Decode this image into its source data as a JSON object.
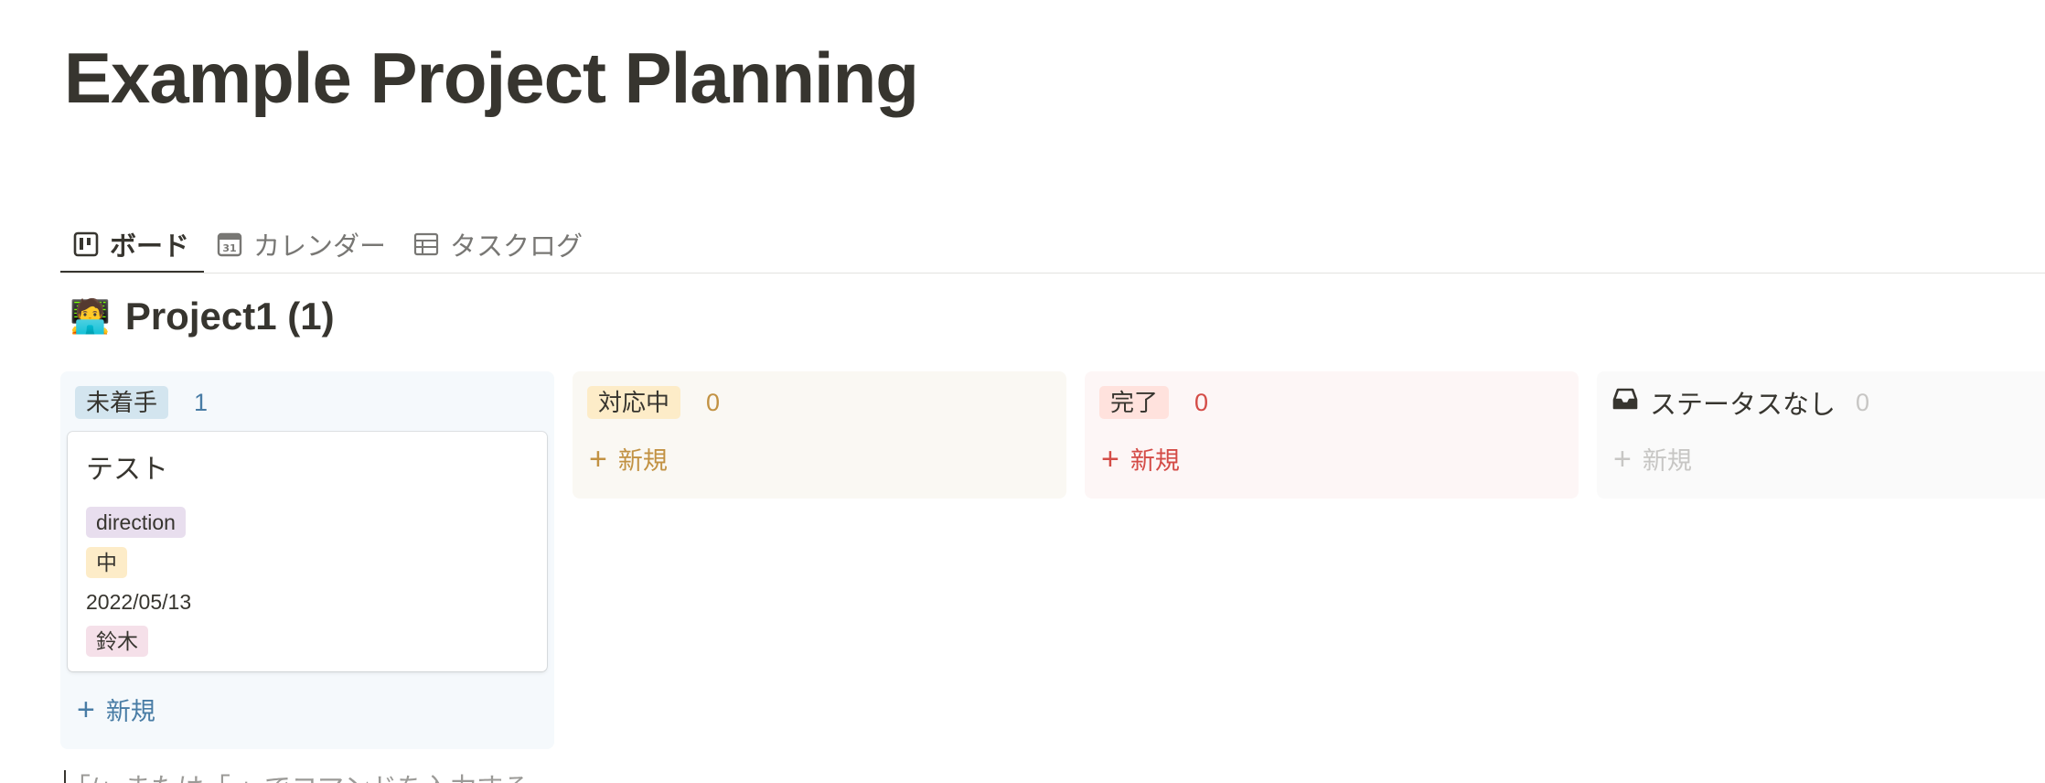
{
  "page": {
    "title": "Example Project Planning"
  },
  "tabs": [
    {
      "label": "ボード",
      "icon": "board-icon",
      "active": true
    },
    {
      "label": "カレンダー",
      "icon": "calendar-icon",
      "calendar_day": "31",
      "active": false
    },
    {
      "label": "タスクログ",
      "icon": "table-icon",
      "active": false
    }
  ],
  "group": {
    "emoji": "🧑‍💻",
    "title": "Project1 (1)"
  },
  "columns": [
    {
      "status": "未着手",
      "count": "1",
      "bg": "#f5f9fc",
      "tag_bg": "#d3e5ef",
      "accent": "#487ca5",
      "new_label": "新規",
      "cards": [
        {
          "title": "テスト",
          "tag1": "direction",
          "tag2": "中",
          "date": "2022/05/13",
          "assignee": "鈴木"
        }
      ]
    },
    {
      "status": "対応中",
      "count": "0",
      "bg": "#faf8f3",
      "tag_bg": "#fdecc8",
      "accent": "#c29243",
      "new_label": "新規"
    },
    {
      "status": "完了",
      "count": "0",
      "bg": "#fdf6f6",
      "tag_bg": "#ffe2dd",
      "accent": "#d44c47",
      "new_label": "新規"
    },
    {
      "status": "ステータスなし",
      "count": "0",
      "icon": "inbox-icon",
      "bg": "#fafafa",
      "accent": "#c7c6c4",
      "new_label": "新規"
    }
  ],
  "tag_colors": {
    "direction": "#e8deee",
    "priority": "#fdecc8",
    "assignee": "#f5e0e9"
  },
  "command_hint": "「/」または「:」でコマンドを入力する"
}
